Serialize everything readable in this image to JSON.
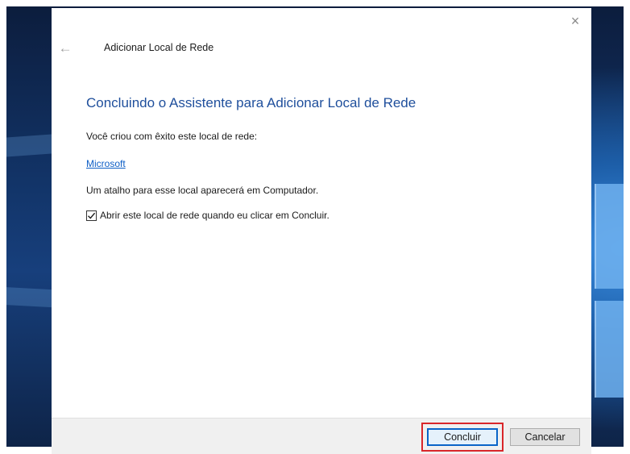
{
  "window": {
    "title": "Adicionar Local de Rede",
    "close_label": "×",
    "back_label": "←"
  },
  "content": {
    "heading": "Concluindo o Assistente para Adicionar Local de Rede",
    "created_text": "Você criou com êxito este local de rede:",
    "location_link": "Microsoft",
    "shortcut_text": "Um atalho para esse local aparecerá em Computador.",
    "open_checkbox": {
      "label": "Abrir este local de rede quando eu clicar em Concluir.",
      "checked": true
    }
  },
  "footer": {
    "finish_label": "Concluir",
    "cancel_label": "Cancelar"
  },
  "colors": {
    "heading": "#1f4f9c",
    "link": "#0f5fc6",
    "highlight": "#d9262a",
    "default_button_border": "#0a64c8"
  }
}
